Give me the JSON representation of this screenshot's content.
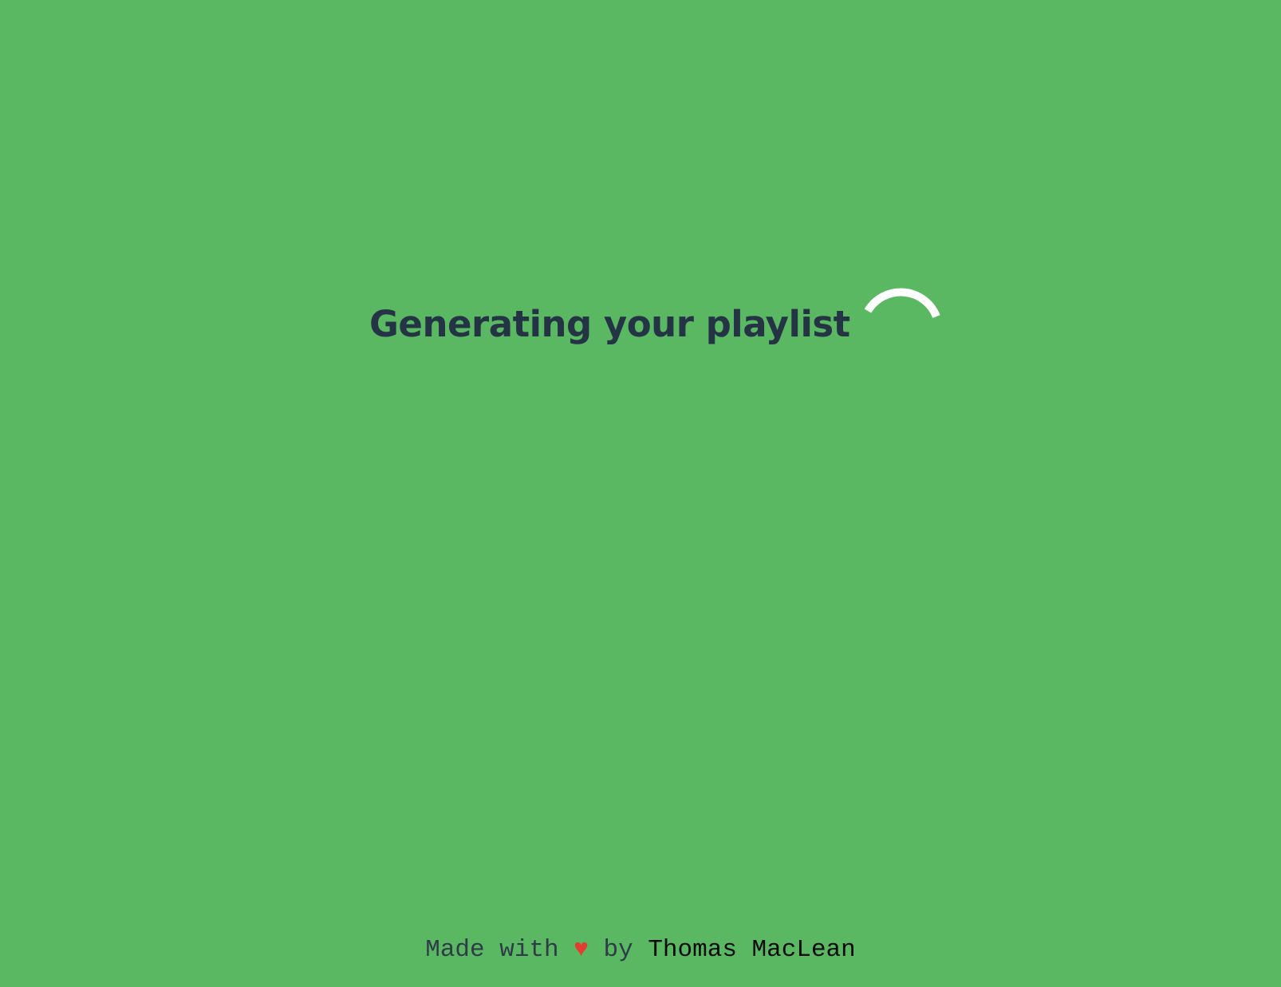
{
  "loading": {
    "heading": "Generating your playlist",
    "spinner_icon": "loading-spinner-icon"
  },
  "footer": {
    "made_with": "Made with",
    "heart": "♥",
    "by": "by",
    "author": "Thomas MacLean"
  },
  "colors": {
    "background": "#5ab762",
    "heading_text": "#253444",
    "spinner": "#ffffff",
    "heart": "#e53b30",
    "footer_text": "#2f3b47",
    "author_link": "#0a0a0a"
  }
}
